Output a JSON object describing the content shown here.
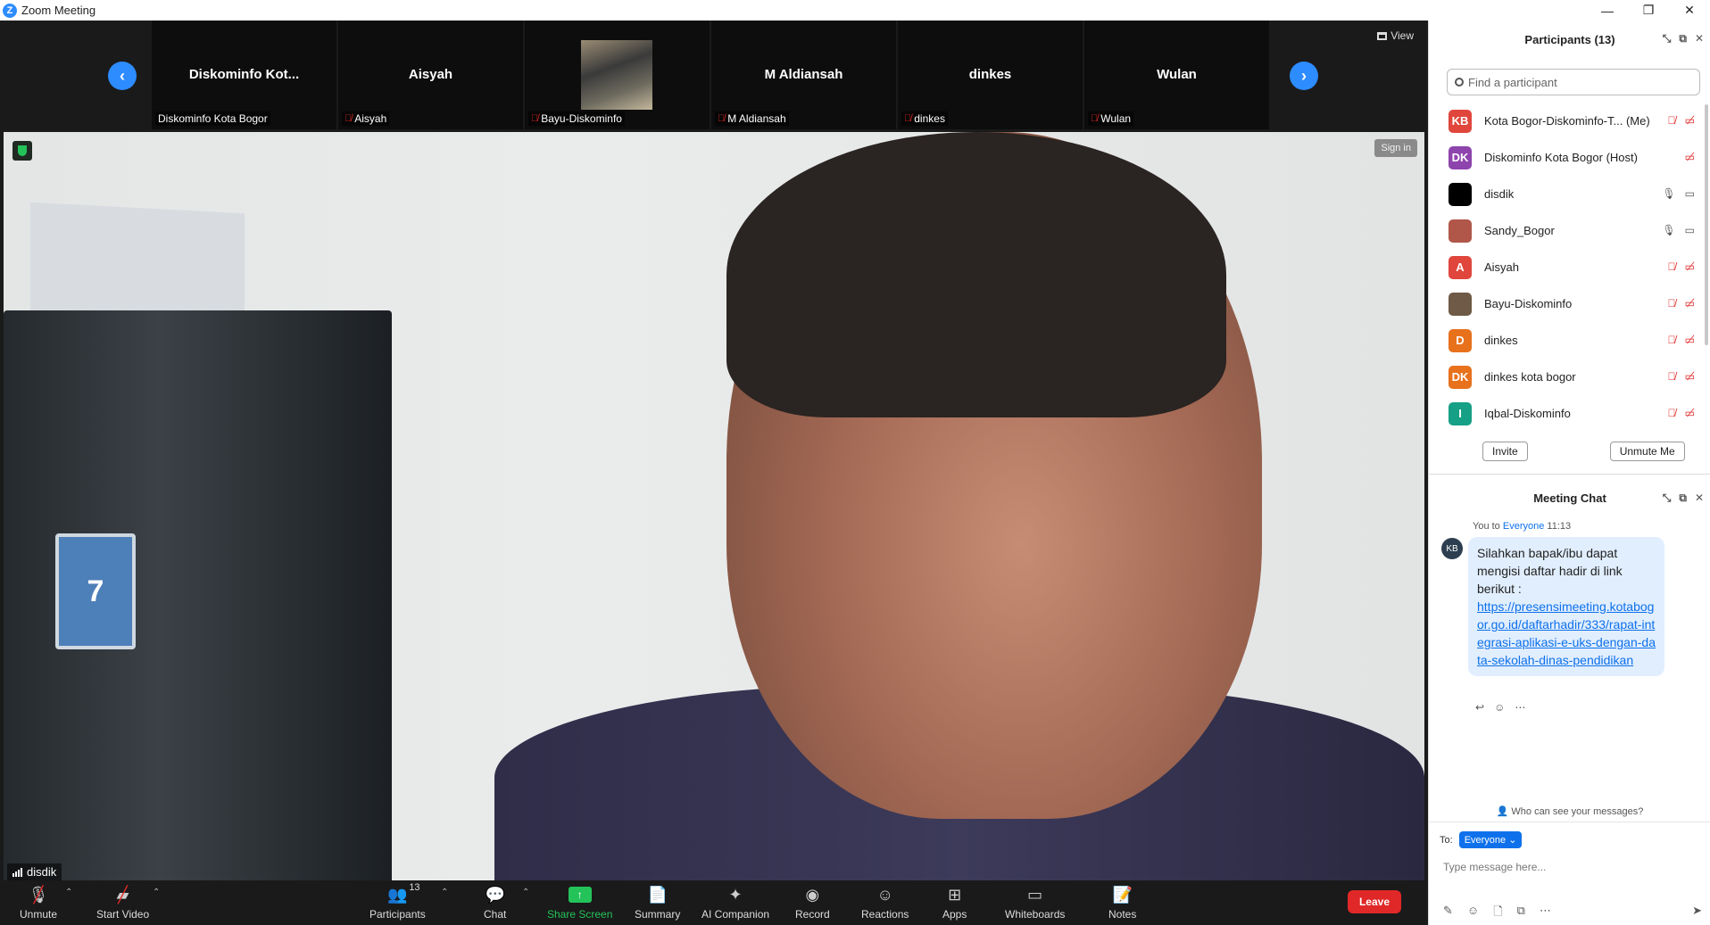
{
  "window": {
    "title": "Zoom Meeting",
    "controls": {
      "minimize": "—",
      "restore": "❐",
      "close": "✕"
    }
  },
  "strip": {
    "view_label": "View",
    "tiles": [
      {
        "name": "Diskominfo  Kot...",
        "label": "Diskominfo Kota Bogor",
        "muted": false,
        "photo": false
      },
      {
        "name": "Aisyah",
        "label": "Aisyah",
        "muted": true,
        "photo": false
      },
      {
        "name": "",
        "label": "Bayu-Diskominfo",
        "muted": true,
        "photo": true
      },
      {
        "name": "M Aldiansah",
        "label": "M Aldiansah",
        "muted": true,
        "photo": false
      },
      {
        "name": "dinkes",
        "label": "dinkes",
        "muted": true,
        "photo": false
      },
      {
        "name": "Wulan",
        "label": "Wulan",
        "muted": true,
        "photo": false
      }
    ]
  },
  "main_video": {
    "speaker_name": "disdik",
    "sign_in_label": "Sign in",
    "sticker_text": "7"
  },
  "toolbar": {
    "unmute": "Unmute",
    "start_video": "Start Video",
    "participants": "Participants",
    "participants_count": "13",
    "chat": "Chat",
    "share_screen": "Share Screen",
    "summary": "Summary",
    "ai_companion": "AI Companion",
    "record": "Record",
    "reactions": "Reactions",
    "apps": "Apps",
    "whiteboards": "Whiteboards",
    "notes": "Notes",
    "leave": "Leave"
  },
  "participants_panel": {
    "title": "Participants (13)",
    "search_placeholder": "Find a participant",
    "rows": [
      {
        "initials": "KB",
        "color": "#e0463c",
        "name": "Kota Bogor-Diskominfo-T... (Me)",
        "mic": "muted",
        "video": "off"
      },
      {
        "initials": "DK",
        "color": "#8e44ad",
        "name": "Diskominfo Kota Bogor (Host)",
        "mic": "none",
        "video": "off"
      },
      {
        "initials": "",
        "color": "#000000",
        "name": "disdik",
        "mic": "on",
        "video": "on"
      },
      {
        "initials": "",
        "color": "#b0574a",
        "name": "Sandy_Bogor",
        "mic": "on",
        "video": "on"
      },
      {
        "initials": "A",
        "color": "#e0463c",
        "name": "Aisyah",
        "mic": "muted",
        "video": "off"
      },
      {
        "initials": "",
        "color": "#6e5a46",
        "name": "Bayu-Diskominfo",
        "mic": "muted",
        "video": "off"
      },
      {
        "initials": "D",
        "color": "#e8711c",
        "name": "dinkes",
        "mic": "muted",
        "video": "off"
      },
      {
        "initials": "DK",
        "color": "#e8711c",
        "name": "dinkes kota bogor",
        "mic": "muted",
        "video": "off"
      },
      {
        "initials": "I",
        "color": "#16a085",
        "name": "Iqbal-Diskominfo",
        "mic": "muted",
        "video": "off"
      }
    ],
    "invite": "Invite",
    "unmute_me": "Unmute Me"
  },
  "chat_panel": {
    "title": "Meeting Chat",
    "sender": "You to",
    "recipient": "Everyone",
    "time": "11:13",
    "avatar_initials": "KB",
    "message_text": "Silahkan bapak/ibu dapat mengisi daftar hadir di link berikut :",
    "message_link": "https://presensimeeting.kotabogor.go.id/daftarhadir/333/rapat-integrasi-aplikasi-e-uks-dengan-data-sekolah-dinas-pendidikan",
    "who_can_see": "Who can see your messages?",
    "to_label": "To:",
    "to_value": "Everyone",
    "input_placeholder": "Type message here..."
  }
}
